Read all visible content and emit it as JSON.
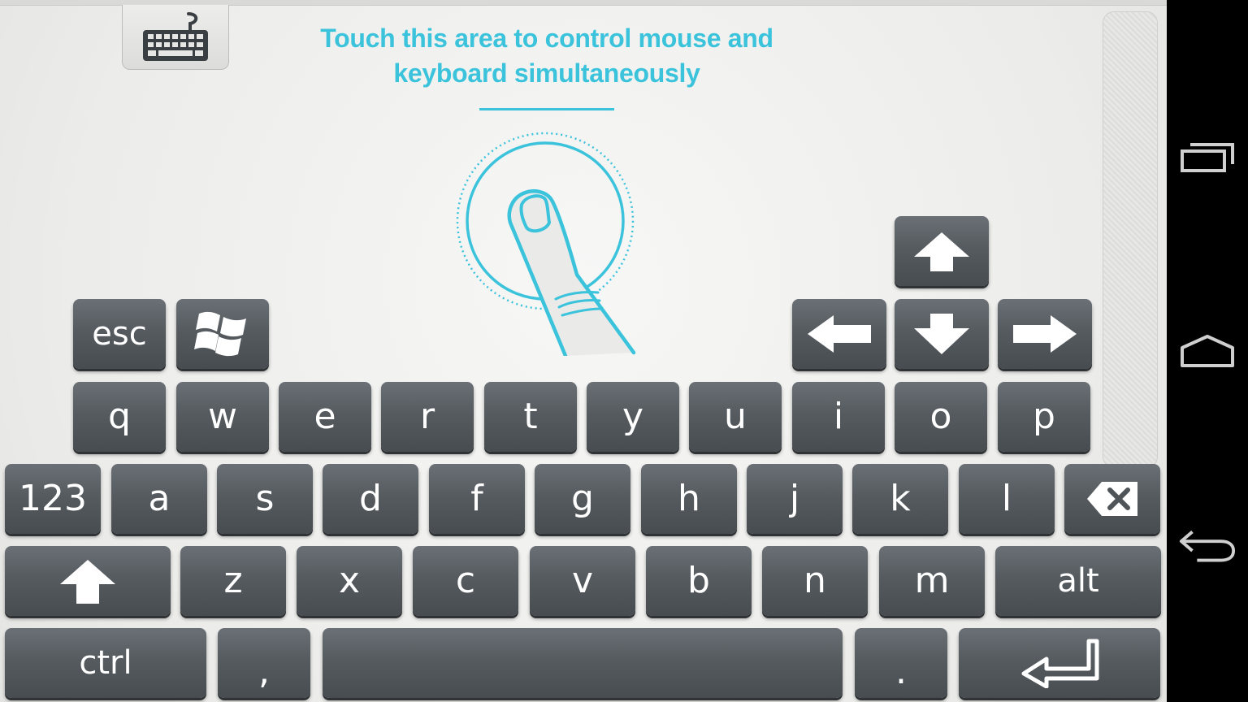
{
  "overlay": {
    "hint_line1": "Touch this area to control mouse and",
    "hint_line2": "keyboard simultaneously",
    "accent_color": "#3cc3dc",
    "graphic_icon": "finger-touch-icon"
  },
  "toolbar": {
    "keyboard_toggle_icon": "keyboard-icon"
  },
  "special_keys": {
    "esc": "esc",
    "windows_icon": "windows-logo-icon"
  },
  "arrow_keys": {
    "up_icon": "arrow-up-icon",
    "down_icon": "arrow-down-icon",
    "left_icon": "arrow-left-icon",
    "right_icon": "arrow-right-icon"
  },
  "keyboard": {
    "row1": [
      "q",
      "w",
      "e",
      "r",
      "t",
      "y",
      "u",
      "i",
      "o",
      "p"
    ],
    "row2": {
      "numbers": "123",
      "letters": [
        "a",
        "s",
        "d",
        "f",
        "g",
        "h",
        "j",
        "k",
        "l"
      ],
      "backspace_icon": "backspace-icon"
    },
    "row3": {
      "shift_icon": "shift-icon",
      "letters": [
        "z",
        "x",
        "c",
        "v",
        "b",
        "n",
        "m"
      ],
      "alt": "alt"
    },
    "row4": {
      "ctrl": "ctrl",
      "comma": ",",
      "period": ".",
      "space_icon": "",
      "enter_icon": "enter-icon"
    }
  },
  "navbar": {
    "recents_icon": "recent-apps-icon",
    "home_icon": "home-icon",
    "back_icon": "back-icon"
  },
  "colors": {
    "key_face": "#565b60",
    "background": "#ececea",
    "navbar": "#000000"
  }
}
